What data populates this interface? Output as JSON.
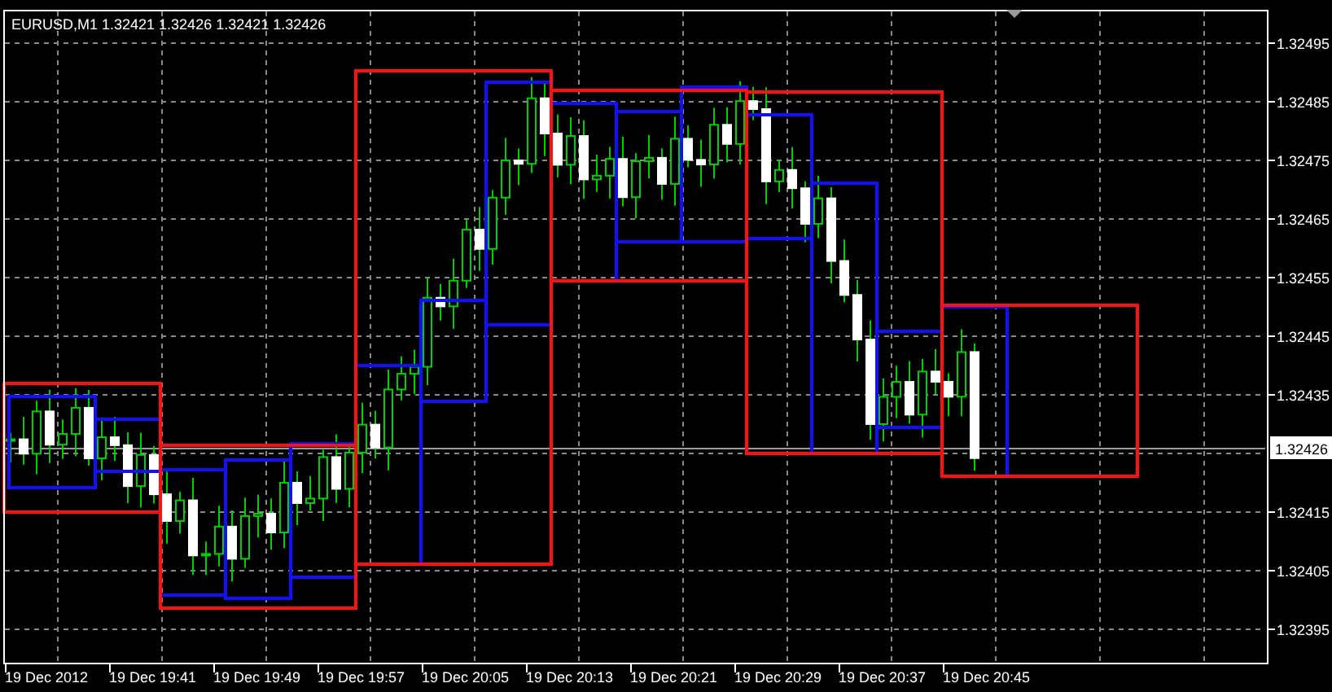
{
  "chart": {
    "title": "EURUSD,M1  1.32421 1.32426 1.32421 1.32426",
    "price_labels": [
      "1.32495",
      "1.32485",
      "1.32475",
      "1.32465",
      "1.32455",
      "1.32445",
      "1.32435",
      "1.32415",
      "1.32405",
      "1.32395"
    ],
    "current_price": "1.32426",
    "time_labels": [
      "19 Dec 2012",
      "19 Dec 19:41",
      "19 Dec 19:49",
      "19 Dec 19:57",
      "19 Dec 20:05",
      "19 Dec 20:13",
      "19 Dec 20:21",
      "19 Dec 20:29",
      "19 Dec 20:37",
      "19 Dec 20:45"
    ]
  }
}
